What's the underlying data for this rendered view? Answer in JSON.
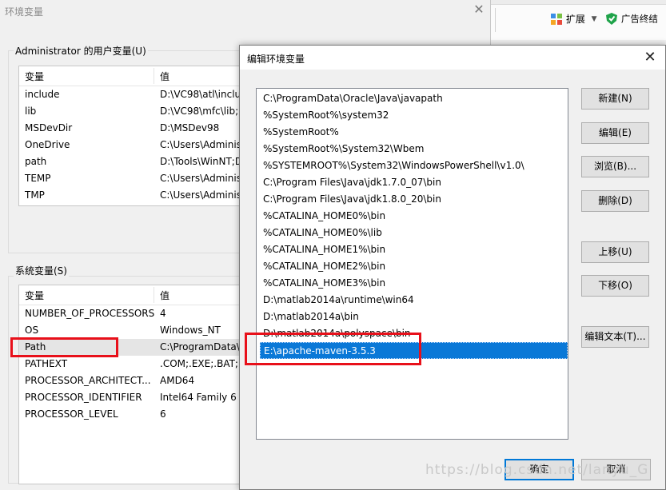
{
  "background_window": {
    "title": "环境变量",
    "user_group_label": "Administrator 的用户变量(U)",
    "system_group_label": "系统变量(S)",
    "columns": [
      "变量",
      "值"
    ],
    "user_vars": [
      {
        "name": "include",
        "value": "D:\\VC98\\atl\\includ"
      },
      {
        "name": "lib",
        "value": "D:\\VC98\\mfc\\lib;D"
      },
      {
        "name": "MSDevDir",
        "value": "D:\\MSDev98"
      },
      {
        "name": "OneDrive",
        "value": "C:\\Users\\Adminis"
      },
      {
        "name": "path",
        "value": "D:\\Tools\\WinNT;D"
      },
      {
        "name": "TEMP",
        "value": "C:\\Users\\Adminis"
      },
      {
        "name": "TMP",
        "value": "C:\\Users\\Adminis"
      }
    ],
    "system_vars": [
      {
        "name": "NUMBER_OF_PROCESSORS",
        "value": "4"
      },
      {
        "name": "OS",
        "value": "Windows_NT"
      },
      {
        "name": "Path",
        "value": "C:\\ProgramData\\("
      },
      {
        "name": "PATHEXT",
        "value": ".COM;.EXE;.BAT;.C"
      },
      {
        "name": "PROCESSOR_ARCHITECT...",
        "value": "AMD64"
      },
      {
        "name": "PROCESSOR_IDENTIFIER",
        "value": "Intel64 Family 6 M"
      },
      {
        "name": "PROCESSOR_LEVEL",
        "value": "6"
      }
    ],
    "selected_system_var": "Path"
  },
  "browser": {
    "extensions_label": "扩展",
    "adblock_label": "广告终结"
  },
  "dialog": {
    "title": "编辑环境变量",
    "path_entries": [
      "C:\\ProgramData\\Oracle\\Java\\javapath",
      "%SystemRoot%\\system32",
      "%SystemRoot%",
      "%SystemRoot%\\System32\\Wbem",
      "%SYSTEMROOT%\\System32\\WindowsPowerShell\\v1.0\\",
      "C:\\Program Files\\Java\\jdk1.7.0_07\\bin",
      "C:\\Program Files\\Java\\jdk1.8.0_20\\bin",
      "%CATALINA_HOME0%\\bin",
      "%CATALINA_HOME0%\\lib",
      "%CATALINA_HOME1%\\bin",
      "%CATALINA_HOME2%\\bin",
      "%CATALINA_HOME3%\\bin",
      "D:\\matlab2014a\\runtime\\win64",
      "D:\\matlab2014a\\bin",
      "D:\\matlab2014a\\polyspace\\bin",
      "E:\\apache-maven-3.5.3"
    ],
    "selected_entry": "E:\\apache-maven-3.5.3",
    "buttons": {
      "new": "新建(N)",
      "edit": "编辑(E)",
      "browse": "浏览(B)...",
      "delete": "删除(D)",
      "move_up": "上移(U)",
      "move_down": "下移(O)",
      "edit_text": "编辑文本(T)...",
      "ok": "确定",
      "cancel": "取消"
    }
  },
  "watermark": "https://blog.csdn.net/lanyu_G",
  "colors": {
    "highlight": "#e8101a",
    "selection": "#0a78d7"
  }
}
